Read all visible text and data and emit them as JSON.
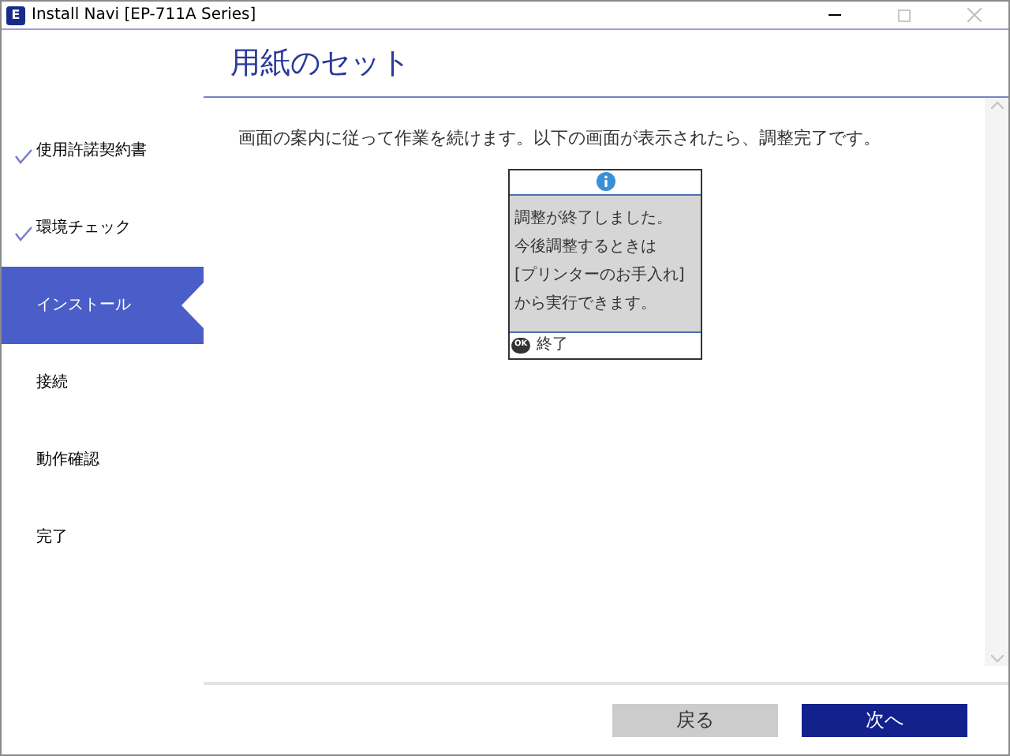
{
  "window": {
    "title": "Install Navi [EP-711A Series]",
    "app_icon": "E"
  },
  "page_title": "用紙のセット",
  "steps": [
    {
      "label": "使用許諾契約書",
      "done": true,
      "selected": false
    },
    {
      "label": "環境チェック",
      "done": true,
      "selected": false
    },
    {
      "label": "インストール",
      "done": false,
      "selected": true
    },
    {
      "label": "接続",
      "done": false,
      "selected": false
    },
    {
      "label": "動作確認",
      "done": false,
      "selected": false
    },
    {
      "label": "完了",
      "done": false,
      "selected": false
    }
  ],
  "instruction": "画面の案内に従って作業を続けます。以下の画面が表示されたら、調整完了です。",
  "printer_screen": {
    "lines": [
      "調整が終了しました。",
      "今後調整するときは",
      "[プリンターのお手入れ]",
      "から実行できます。"
    ],
    "ok_key": "OK",
    "ok_label": "終了"
  },
  "buttons": {
    "back": "戻る",
    "next": "次へ"
  }
}
